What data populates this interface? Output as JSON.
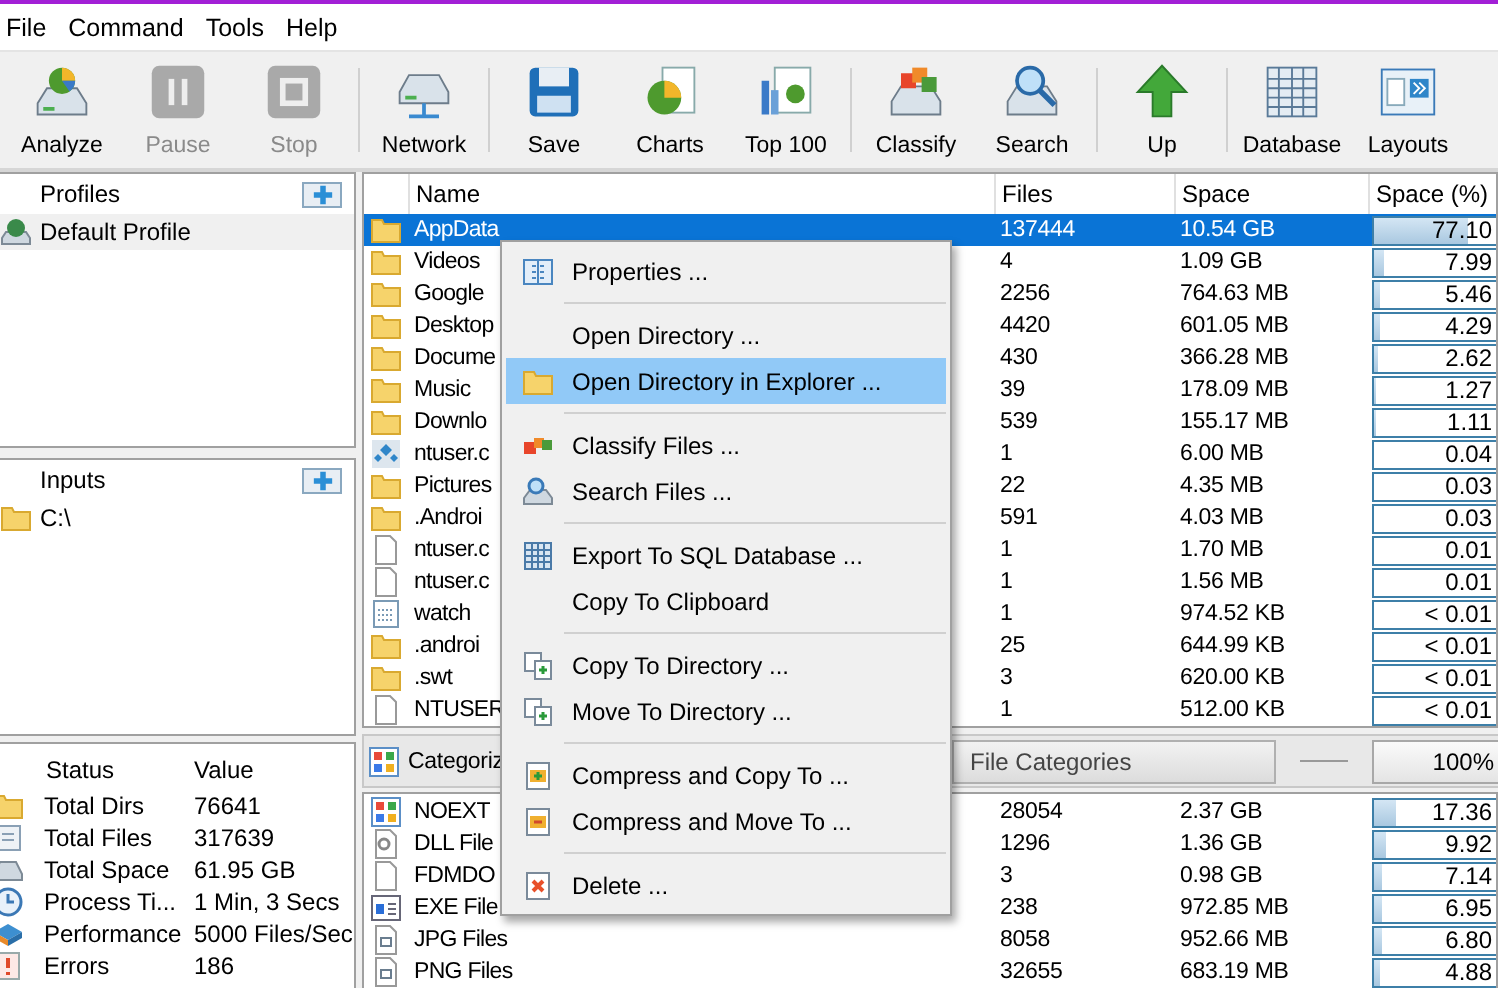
{
  "menubar": [
    "File",
    "Command",
    "Tools",
    "Help"
  ],
  "toolbar": {
    "groups": [
      [
        {
          "label": "Analyze",
          "disabled": false
        },
        {
          "label": "Pause",
          "disabled": true
        },
        {
          "label": "Stop",
          "disabled": true
        }
      ],
      [
        {
          "label": "Network",
          "disabled": false
        }
      ],
      [
        {
          "label": "Save",
          "disabled": false
        },
        {
          "label": "Charts",
          "disabled": false
        },
        {
          "label": "Top 100",
          "disabled": false
        }
      ],
      [
        {
          "label": "Classify",
          "disabled": false
        },
        {
          "label": "Search",
          "disabled": false
        }
      ],
      [
        {
          "label": "Up",
          "disabled": false
        }
      ],
      [
        {
          "label": "Database",
          "disabled": false
        },
        {
          "label": "Layouts",
          "disabled": false
        }
      ]
    ]
  },
  "profiles": {
    "title": "Profiles",
    "items": [
      {
        "name": "Default Profile",
        "selected": true
      }
    ]
  },
  "inputs": {
    "title": "Inputs",
    "items": [
      {
        "path": "C:\\"
      }
    ]
  },
  "status": {
    "columns": [
      "Status",
      "Value"
    ],
    "rows": [
      {
        "status": "Total Dirs",
        "value": "76641"
      },
      {
        "status": "Total Files",
        "value": "317639"
      },
      {
        "status": "Total Space",
        "value": "61.95 GB"
      },
      {
        "status": "Process Ti...",
        "value": "1 Min, 3 Secs"
      },
      {
        "status": "Performance",
        "value": "5000 Files/Sec"
      },
      {
        "status": "Errors",
        "value": "186"
      }
    ]
  },
  "files": {
    "columns": [
      "Name",
      "Files",
      "Space",
      "Space (%)"
    ],
    "rows": [
      {
        "kind": "folder",
        "name": "AppData",
        "files": "137444",
        "space": "10.54 GB",
        "percent": "77.10",
        "level": 0.771,
        "selected": true
      },
      {
        "kind": "folder",
        "name": "Videos",
        "files": "4",
        "space": "1.09 GB",
        "percent": "7.99",
        "level": 0.0799,
        "selected": false
      },
      {
        "kind": "folder",
        "name": "Google",
        "files": "2256",
        "space": "764.63 MB",
        "percent": "5.46",
        "level": 0.0546,
        "selected": false
      },
      {
        "kind": "folder",
        "name": "Desktop",
        "files": "4420",
        "space": "601.05 MB",
        "percent": "4.29",
        "level": 0.0429,
        "selected": false
      },
      {
        "kind": "folder",
        "name": "Docume",
        "files": "430",
        "space": "366.28 MB",
        "percent": "2.62",
        "level": 0.0262,
        "selected": false
      },
      {
        "kind": "folder",
        "name": "Music",
        "files": "39",
        "space": "178.09 MB",
        "percent": "1.27",
        "level": 0.0127,
        "selected": false
      },
      {
        "kind": "folder",
        "name": "Downlo",
        "files": "539",
        "space": "155.17 MB",
        "percent": "1.11",
        "level": 0.0111,
        "selected": false
      },
      {
        "kind": "app",
        "name": "ntuser.c",
        "files": "1",
        "space": "6.00 MB",
        "percent": "0.04",
        "level": 0.0004,
        "selected": false
      },
      {
        "kind": "folder",
        "name": "Pictures",
        "files": "22",
        "space": "4.35 MB",
        "percent": "0.03",
        "level": 0.0003,
        "selected": false
      },
      {
        "kind": "folder",
        "name": ".Androi",
        "files": "591",
        "space": "4.03 MB",
        "percent": "0.03",
        "level": 0.0003,
        "selected": false
      },
      {
        "kind": "file",
        "name": "ntuser.c",
        "files": "1",
        "space": "1.70 MB",
        "percent": "0.01",
        "level": 0.0001,
        "selected": false
      },
      {
        "kind": "file",
        "name": "ntuser.c",
        "files": "1",
        "space": "1.56 MB",
        "percent": "0.01",
        "level": 0.0001,
        "selected": false
      },
      {
        "kind": "calendar",
        "name": "watch",
        "files": "1",
        "space": "974.52 KB",
        "percent": "< 0.01",
        "level": 0,
        "selected": false
      },
      {
        "kind": "folder",
        "name": ".androi",
        "files": "25",
        "space": "644.99 KB",
        "percent": "< 0.01",
        "level": 0,
        "selected": false
      },
      {
        "kind": "folder",
        "name": ".swt",
        "files": "3",
        "space": "620.00 KB",
        "percent": "< 0.01",
        "level": 0,
        "selected": false
      },
      {
        "kind": "file",
        "name": "NTUSER",
        "files": "1",
        "space": "512.00 KB",
        "percent": "< 0.01",
        "level": 0,
        "selected": false
      }
    ]
  },
  "category_bar": {
    "label": "Categoriz",
    "type": "File Categories",
    "total": "100%"
  },
  "categories": {
    "rows": [
      {
        "name": "NOEXT",
        "files": "28054",
        "space": "2.37 GB",
        "percent": "17.36",
        "level": 0.1736
      },
      {
        "name": "DLL File",
        "files": "1296",
        "space": "1.36 GB",
        "percent": "9.92",
        "level": 0.0992
      },
      {
        "name": "FDMDO",
        "files": "3",
        "space": "0.98 GB",
        "percent": "7.14",
        "level": 0.0714
      },
      {
        "name": "EXE File",
        "files": "238",
        "space": "972.85 MB",
        "percent": "6.95",
        "level": 0.0695
      },
      {
        "name": "JPG Files",
        "files": "8058",
        "space": "952.66 MB",
        "percent": "6.80",
        "level": 0.068
      },
      {
        "name": "PNG Files",
        "files": "32655",
        "space": "683.19 MB",
        "percent": "4.88",
        "level": 0.0488
      }
    ]
  },
  "context_menu": {
    "groups": [
      [
        {
          "label": "Properties ...",
          "selected": false
        }
      ],
      [
        {
          "label": "Open Directory ...",
          "selected": false
        },
        {
          "label": "Open Directory in Explorer ...",
          "selected": true
        }
      ],
      [
        {
          "label": "Classify Files ...",
          "selected": false
        },
        {
          "label": "Search Files ...",
          "selected": false
        }
      ],
      [
        {
          "label": "Export To SQL Database ...",
          "selected": false
        },
        {
          "label": "Copy To Clipboard",
          "selected": false
        }
      ],
      [
        {
          "label": "Copy To Directory ...",
          "selected": false
        },
        {
          "label": "Move To Directory ...",
          "selected": false
        }
      ],
      [
        {
          "label": "Compress and Copy To ...",
          "selected": false
        },
        {
          "label": "Compress and Move To ...",
          "selected": false
        }
      ],
      [
        {
          "label": "Delete ...",
          "selected": false
        }
      ]
    ]
  }
}
